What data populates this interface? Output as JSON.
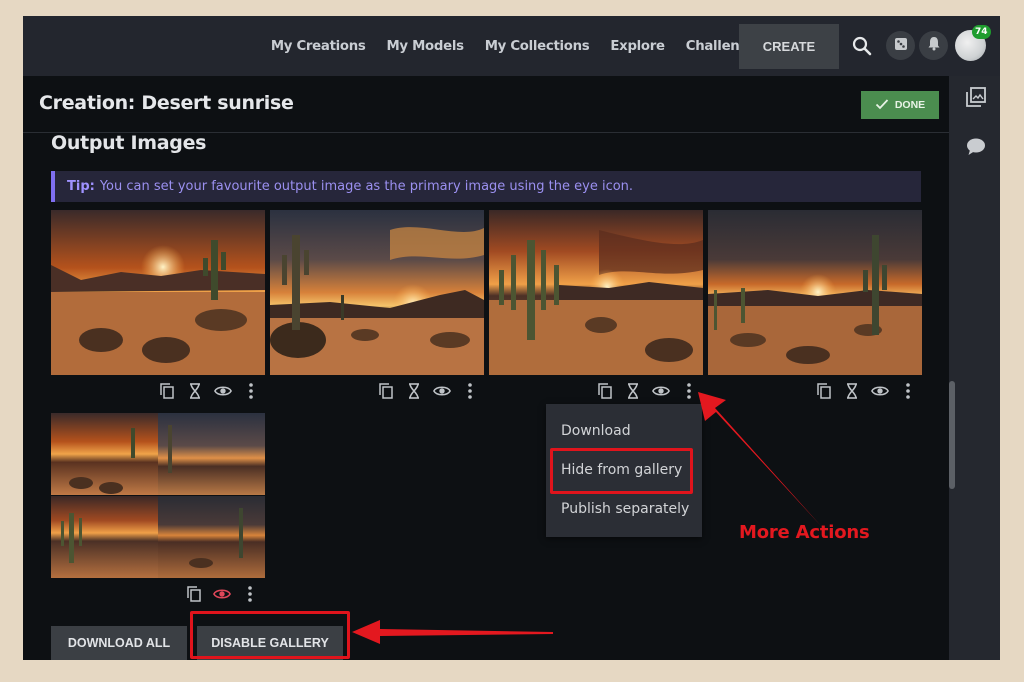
{
  "nav": {
    "links": [
      "My Creations",
      "My Models",
      "My Collections",
      "Explore",
      "Challenges"
    ],
    "create_label": "CREATE",
    "icons": [
      "search-icon",
      "dice-icon",
      "bell-icon",
      "avatar"
    ],
    "avatar_badge": "74"
  },
  "header": {
    "title": "Creation: Desert sunrise",
    "done_label": "DONE",
    "done_icon": "check-icon"
  },
  "side_panel": {
    "icons": [
      "gallery-icon",
      "comment-icon"
    ]
  },
  "section": {
    "title": "Output Images",
    "tip_label": "Tip:",
    "tip_text": "You can set your favourite output image as the primary image using the eye icon."
  },
  "images": [
    {
      "alt": "Desert sunrise 1",
      "actions": [
        "copy-icon",
        "dna-icon",
        "eye-icon",
        "more-icon"
      ]
    },
    {
      "alt": "Desert sunrise 2",
      "actions": [
        "copy-icon",
        "dna-icon",
        "eye-icon",
        "more-icon"
      ]
    },
    {
      "alt": "Desert sunrise 3",
      "actions": [
        "copy-icon",
        "dna-icon",
        "eye-icon",
        "more-icon"
      ]
    },
    {
      "alt": "Desert sunrise 4",
      "actions": [
        "copy-icon",
        "dna-icon",
        "eye-icon",
        "more-icon"
      ]
    },
    {
      "alt": "Desert sunrise grid",
      "actions": [
        "copy-icon",
        "eye-icon",
        "more-icon"
      ],
      "primary": true
    }
  ],
  "more_menu": {
    "items": [
      "Download",
      "Hide from gallery",
      "Publish separately"
    ]
  },
  "buttons": {
    "download_all": "DOWNLOAD ALL",
    "disable_gallery": "DISABLE GALLERY"
  },
  "annotation": {
    "label": "More Actions",
    "color": "#e3181f"
  },
  "colors": {
    "accent_tip": "#7f6ff0",
    "done_green": "#4b8d4f",
    "primary_eye": "#e2475a",
    "badge_green": "#1f9d2f"
  }
}
